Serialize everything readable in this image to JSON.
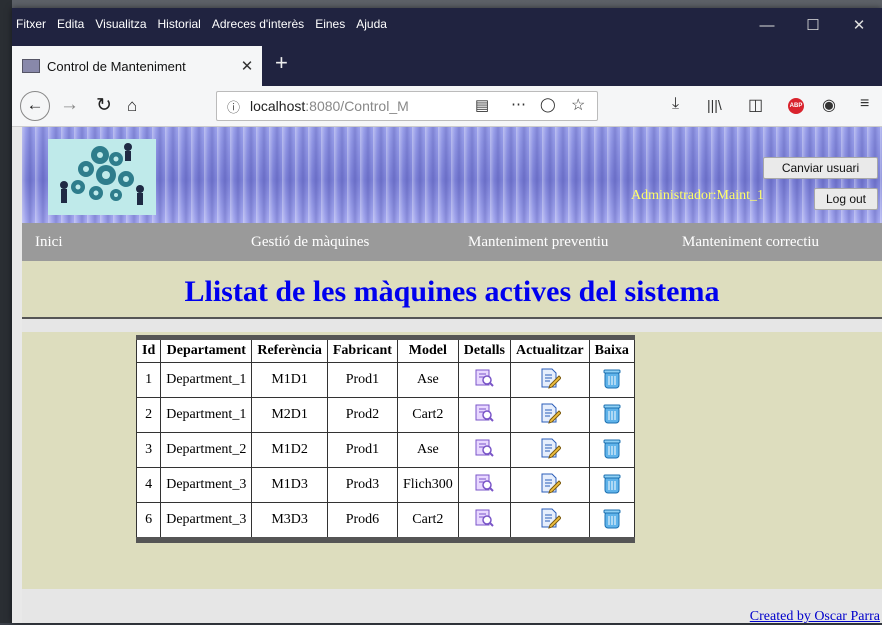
{
  "browser": {
    "menu": [
      "Fitxer",
      "Edita",
      "Visualitza",
      "Historial",
      "Adreces d'interès",
      "Eines",
      "Ajuda"
    ],
    "tab_title": "Control de Manteniment",
    "url_host": "localhost",
    "url_rest": ":8080/Control_M",
    "abp_label": "ABP"
  },
  "header": {
    "change_user_label": "Canviar usuari",
    "user_label": "Administrador:Maint_1",
    "logout_label": "Log out"
  },
  "nav": {
    "items": [
      "Inici",
      "Gestió de màquines",
      "Manteniment preventiu",
      "Manteniment correctiu"
    ]
  },
  "page": {
    "title": "Llistat de les màquines actives del sistema",
    "footer_link": "Created by Oscar Parra"
  },
  "table": {
    "columns": [
      "Id",
      "Departament",
      "Referència",
      "Fabricant",
      "Model",
      "Detalls",
      "Actualitzar",
      "Baixa"
    ],
    "rows": [
      {
        "id": "1",
        "departament": "Department_1",
        "referencia": "M1D1",
        "fabricant": "Prod1",
        "model": "Ase"
      },
      {
        "id": "2",
        "departament": "Department_1",
        "referencia": "M2D1",
        "fabricant": "Prod2",
        "model": "Cart2"
      },
      {
        "id": "3",
        "departament": "Department_2",
        "referencia": "M1D2",
        "fabricant": "Prod1",
        "model": "Ase"
      },
      {
        "id": "4",
        "departament": "Department_3",
        "referencia": "M1D3",
        "fabricant": "Prod3",
        "model": "Flich300"
      },
      {
        "id": "6",
        "departament": "Department_3",
        "referencia": "M3D3",
        "fabricant": "Prod6",
        "model": "Cart2"
      }
    ]
  },
  "colors": {
    "title_blue": "#0000ee",
    "banner_blue": "#8b91e0",
    "band_beige": "#ddddbe",
    "nav_gray": "#9a9a9a",
    "user_yellow": "#ffff66"
  }
}
